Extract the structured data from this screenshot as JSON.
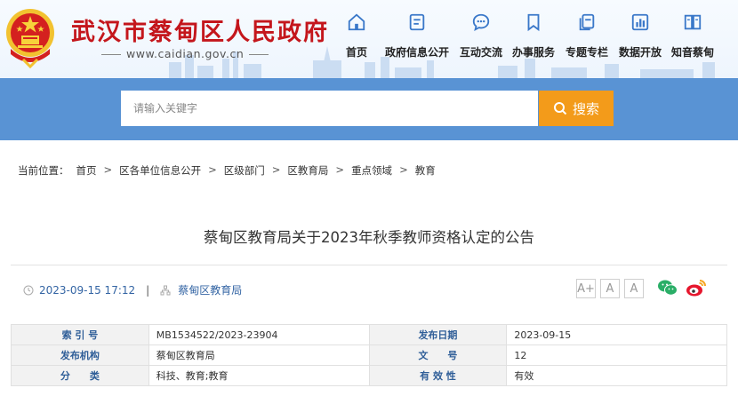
{
  "header": {
    "site_title": "武汉市蔡甸区人民政府",
    "site_url": "www.caidian.gov.cn",
    "nav": [
      {
        "label": "首页",
        "icon": "home-icon"
      },
      {
        "label": "政府信息公开",
        "icon": "document-icon"
      },
      {
        "label": "互动交流",
        "icon": "chat-icon"
      },
      {
        "label": "办事服务",
        "icon": "bookmark-icon"
      },
      {
        "label": "专题专栏",
        "icon": "copy-icon"
      },
      {
        "label": "数据开放",
        "icon": "bar-chart-icon"
      },
      {
        "label": "知音蔡甸",
        "icon": "book-icon"
      }
    ],
    "colors": {
      "title": "#c4161c",
      "nav_icon": "#3a78c9"
    }
  },
  "search": {
    "placeholder": "请输入关键字",
    "button_label": "搜索",
    "colors": {
      "band": "#5993d4",
      "button": "#f39b1a"
    }
  },
  "breadcrumb": {
    "prefix": "当前位置：",
    "items": [
      "首页",
      "区各单位信息公开",
      "区级部门",
      "区教育局",
      "重点领域",
      "教育"
    ],
    "separator": ">"
  },
  "article": {
    "title": "蔡甸区教育局关于2023年秋季教师资格认定的公告",
    "datetime": "2023-09-15 17:12",
    "publisher": "蔡甸区教育局",
    "font_buttons": [
      "A+",
      "A",
      "A"
    ],
    "share_icons": [
      "wechat-icon",
      "weibo-icon"
    ]
  },
  "info_table": {
    "rows": [
      [
        {
          "k": "索 引 号",
          "v": "MB1534522/2023-23904"
        },
        {
          "k": "发布日期",
          "v": "2023-09-15"
        }
      ],
      [
        {
          "k": "发布机构",
          "v": "蔡甸区教育局"
        },
        {
          "k": "文　　号",
          "v": "12"
        }
      ],
      [
        {
          "k": "分　　类",
          "v": "科技、教育;教育"
        },
        {
          "k": "有 效 性",
          "v": "有效"
        }
      ]
    ]
  }
}
